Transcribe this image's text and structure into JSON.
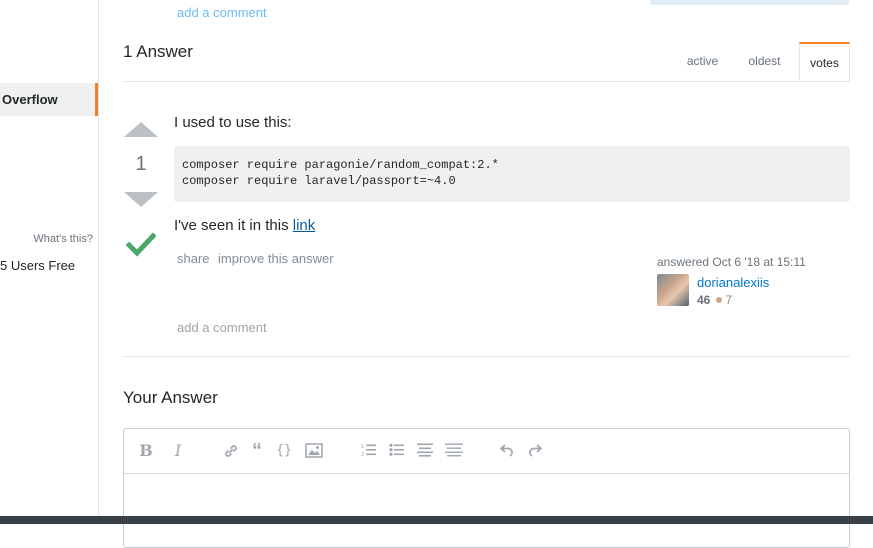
{
  "top": {
    "add_comment": "add a comment"
  },
  "sidebar": {
    "active_item": "Overflow",
    "whats_this": "What's this?",
    "promo_text": "5 Users Free"
  },
  "answers": {
    "header": "1 Answer",
    "tabs": [
      {
        "label": "active"
      },
      {
        "label": "oldest"
      },
      {
        "label": "votes",
        "selected": true
      }
    ]
  },
  "answer": {
    "vote_count": "1",
    "accepted": true,
    "intro": "I used to use this:",
    "code_lines": [
      "composer require paragonie/random_compat:2.*",
      "composer require laravel/passport=~4.0"
    ],
    "seen_prefix": "I've seen it in this ",
    "link_text": "link",
    "menu": {
      "share": "share",
      "improve": "improve this answer"
    },
    "user_card": {
      "answered": "answered Oct 6 '18 at 15:11",
      "username": "dorianalexiis",
      "reputation": "46",
      "bronze_badges": "7"
    },
    "add_comment": "add a comment"
  },
  "your_answer": {
    "title": "Your Answer",
    "toolbar": [
      "bold",
      "italic",
      "link",
      "blockquote",
      "code",
      "image",
      "numbered-list",
      "bulleted-list",
      "heading",
      "horizontal-rule",
      "undo",
      "redo"
    ]
  },
  "colors": {
    "accent": "#f48024",
    "link": "#0077cc",
    "accepted": "#48a868",
    "vote_arrow": "#bbc0c4"
  }
}
